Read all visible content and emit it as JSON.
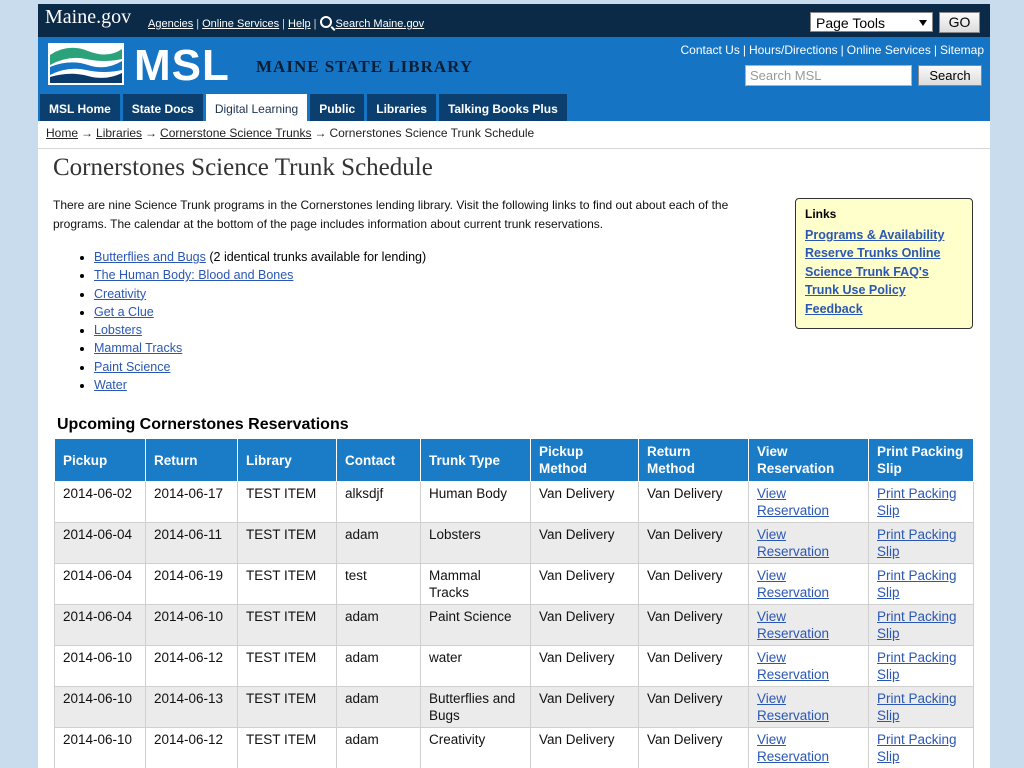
{
  "topbar": {
    "logo": "Maine.gov",
    "links": [
      "Agencies",
      "Online Services",
      "Help",
      "Search Maine.gov"
    ],
    "page_tools": "Page Tools",
    "go": "GO"
  },
  "header": {
    "logo_text": "MSL",
    "subtitle": "MAINE STATE LIBRARY",
    "links": [
      "Contact Us",
      "Hours/Directions",
      "Online Services",
      "Sitemap"
    ],
    "search_placeholder": "Search MSL",
    "search_button": "Search",
    "tabs": [
      "MSL Home",
      "State Docs",
      "Digital Learning",
      "Public",
      "Libraries",
      "Talking Books Plus"
    ],
    "active_tab": "Digital Learning"
  },
  "breadcrumb": [
    "Home",
    "Libraries",
    "Cornerstone Science Trunks",
    "Cornerstones Science Trunk Schedule"
  ],
  "page": {
    "title": "Cornerstones Science Trunk Schedule",
    "intro": "There are nine Science Trunk programs in the Cornerstones lending library. Visit the following links to find out about each of the programs. The calendar at the bottom of the page includes information about current trunk reservations."
  },
  "trunks": [
    {
      "name": "Butterflies and Bugs",
      "note": "(2 identical trunks available for lending)"
    },
    {
      "name": "The Human Body: Blood and Bones",
      "note": ""
    },
    {
      "name": "Creativity",
      "note": ""
    },
    {
      "name": "Get a Clue",
      "note": ""
    },
    {
      "name": "Lobsters",
      "note": ""
    },
    {
      "name": "Mammal Tracks",
      "note": ""
    },
    {
      "name": "Paint Science",
      "note": ""
    },
    {
      "name": "Water",
      "note": ""
    }
  ],
  "sidebar": {
    "title": "Links",
    "items": [
      "Programs & Availability",
      "Reserve Trunks Online",
      "Science Trunk FAQ's",
      "Trunk Use Policy",
      "Feedback"
    ]
  },
  "reservations": {
    "heading": "Upcoming Cornerstones Reservations",
    "columns": [
      "Pickup",
      "Return",
      "Library",
      "Contact",
      "Trunk Type",
      "Pickup Method",
      "Return Method",
      "View Reservation",
      "Print Packing Slip"
    ],
    "view_label": "View Reservation",
    "print_label": "Print Packing Slip",
    "rows": [
      {
        "pickup": "2014-06-02",
        "return": "2014-06-17",
        "library": "TEST ITEM",
        "contact": "alksdjf",
        "trunk": "Human Body",
        "pickup_method": "Van Delivery",
        "return_method": "Van Delivery"
      },
      {
        "pickup": "2014-06-04",
        "return": "2014-06-11",
        "library": "TEST ITEM",
        "contact": "adam",
        "trunk": "Lobsters",
        "pickup_method": "Van Delivery",
        "return_method": "Van Delivery"
      },
      {
        "pickup": "2014-06-04",
        "return": "2014-06-19",
        "library": "TEST ITEM",
        "contact": "test",
        "trunk": "Mammal Tracks",
        "pickup_method": "Van Delivery",
        "return_method": "Van Delivery"
      },
      {
        "pickup": "2014-06-04",
        "return": "2014-06-10",
        "library": "TEST ITEM",
        "contact": "adam",
        "trunk": "Paint Science",
        "pickup_method": "Van Delivery",
        "return_method": "Van Delivery"
      },
      {
        "pickup": "2014-06-10",
        "return": "2014-06-12",
        "library": "TEST ITEM",
        "contact": "adam",
        "trunk": "water",
        "pickup_method": "Van Delivery",
        "return_method": "Van Delivery"
      },
      {
        "pickup": "2014-06-10",
        "return": "2014-06-13",
        "library": "TEST ITEM",
        "contact": "adam",
        "trunk": "Butterflies and Bugs",
        "pickup_method": "Van Delivery",
        "return_method": "Van Delivery"
      },
      {
        "pickup": "2014-06-10",
        "return": "2014-06-12",
        "library": "TEST ITEM",
        "contact": "adam",
        "trunk": "Creativity",
        "pickup_method": "Van Delivery",
        "return_method": "Van Delivery"
      }
    ]
  },
  "colors": {
    "header_blue": "#1574c4",
    "topbar_navy": "#0a2a47",
    "table_header": "#1a7bc6",
    "link": "#2b57b4",
    "links_box_bg": "#ffffcc"
  }
}
